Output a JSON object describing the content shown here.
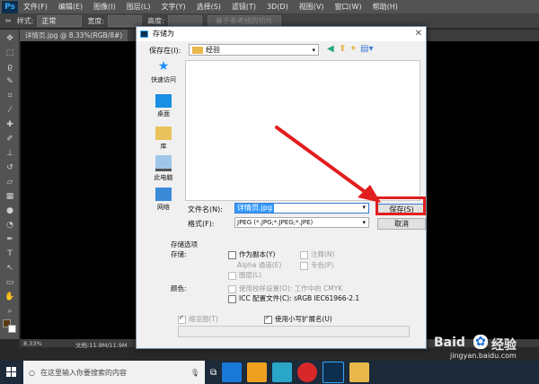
{
  "menubar": {
    "logo": "Ps",
    "items": [
      "文件(F)",
      "编辑(E)",
      "图像(I)",
      "图层(L)",
      "文字(Y)",
      "选择(S)",
      "滤镜(T)",
      "3D(D)",
      "视图(V)",
      "窗口(W)",
      "帮助(H)"
    ]
  },
  "options": {
    "style_label": "样式:",
    "style_value": "正常",
    "width_label": "宽度:",
    "height_label": "高度:",
    "refine_button": "基于参考线的切片"
  },
  "document": {
    "tab_label": "详情页.jpg @ 8.33%(RGB/8#)",
    "zoom": "8.33%",
    "doc_info": "文档:11.9M/11.9M"
  },
  "dialog": {
    "title": "存储为",
    "save_in_label": "保存在(I):",
    "save_in_value": "经验",
    "places": [
      "快速访问",
      "桌面",
      "库",
      "此电脑",
      "网络"
    ],
    "filename_label": "文件名(N):",
    "filename_value": "详情页.jpg",
    "format_label": "格式(F):",
    "format_value": "JPEG (*.JPG;*.JPEG;*.JPE)",
    "save_button": "保存(S)",
    "cancel_button": "取消",
    "options_title": "存储选项",
    "storage_label": "存储:",
    "as_copy": "作为副本(Y)",
    "notes": "注释(N)",
    "alpha": "Alpha 通道(E)",
    "spot": "专色(P)",
    "layers": "图层(L)",
    "color_label": "颜色:",
    "use_proof": "使用校样设置(O): 工作中的 CMYK",
    "icc": "ICC 配置文件(C): sRGB IEC61966-2.1",
    "thumbnail": "缩览图(T)",
    "lowercase_ext": "使用小写扩展名(U)"
  },
  "taskbar": {
    "search_placeholder": "在这里输入你要搜索的内容"
  },
  "watermark": {
    "brand": "Baid",
    "brand2": "经验",
    "url": "jingyan.baidu.com"
  },
  "colors": {
    "accent_red": "#e21d1d",
    "ps_blue": "#31a8ff",
    "selection_blue": "#3399ff"
  }
}
